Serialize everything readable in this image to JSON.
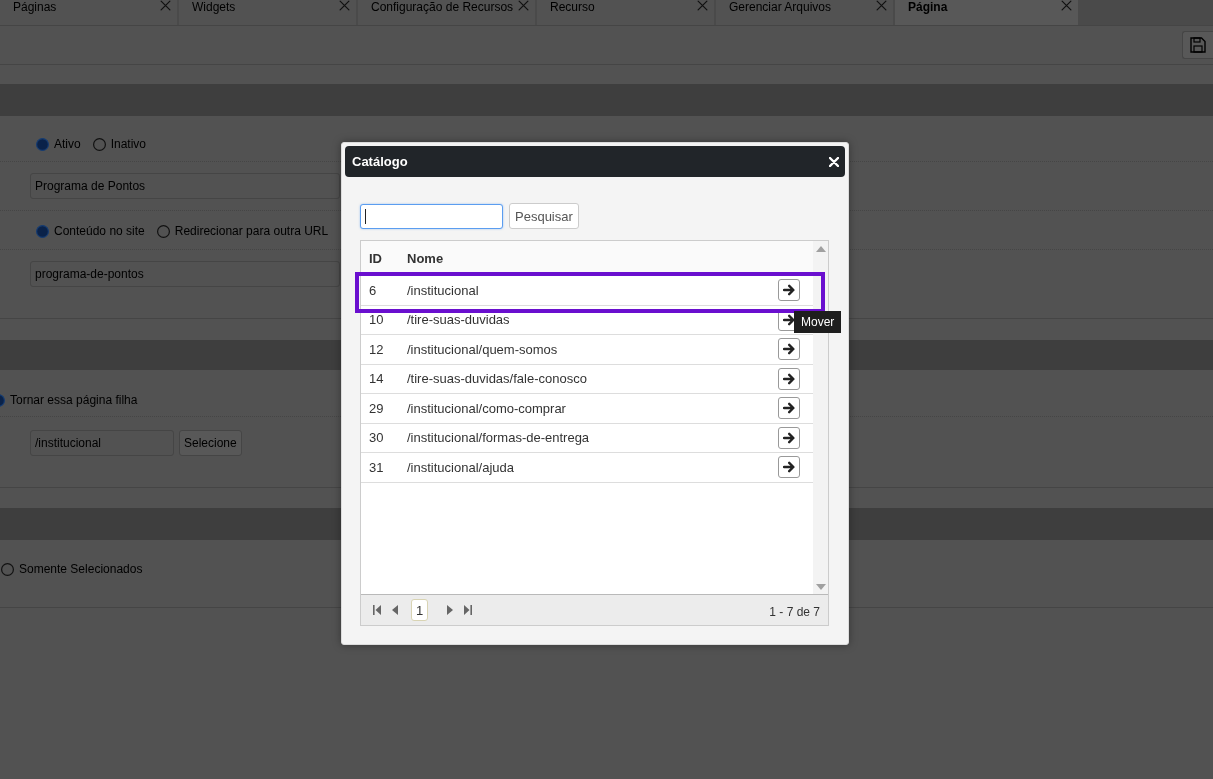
{
  "tabs": [
    {
      "label": "Páginas",
      "selected": false
    },
    {
      "label": "Widgets",
      "selected": false
    },
    {
      "label": "Configuração de Recursos",
      "selected": false
    },
    {
      "label": "Recurso",
      "selected": false
    },
    {
      "label": "Gerenciar Arquivos",
      "selected": false
    },
    {
      "label": "Página",
      "selected": true
    }
  ],
  "form": {
    "status_options": [
      {
        "label": "Ativo",
        "selected": true
      },
      {
        "label": "Inativo",
        "selected": false
      }
    ],
    "title_field": {
      "value": "Programa de Pontos"
    },
    "content_options": [
      {
        "label": "Conteúdo no site",
        "selected": true
      },
      {
        "label": "Redirecionar para outra URL",
        "selected": false
      }
    ],
    "slug_field": {
      "value": "programa-de-pontos"
    },
    "parent_option": {
      "label": "Tornar essa página filha",
      "selected": true
    },
    "parent_field": {
      "value": "/institucional"
    },
    "parent_button": "Selecione",
    "visibility_option": {
      "label": "Somente Selecionados",
      "selected": false
    }
  },
  "modal": {
    "title": "Catálogo",
    "search": {
      "focused": true,
      "button": "Pesquisar"
    },
    "table": {
      "columns": [
        "ID",
        "Nome"
      ],
      "rows": [
        {
          "id": "6",
          "name": "/institucional",
          "highlighted": true,
          "tooltip": "Mover"
        },
        {
          "id": "10",
          "name": "/tire-suas-duvidas",
          "highlighted": false
        },
        {
          "id": "12",
          "name": "/institucional/quem-somos",
          "highlighted": false
        },
        {
          "id": "14",
          "name": "/tire-suas-duvidas/fale-conosco",
          "highlighted": false
        },
        {
          "id": "29",
          "name": "/institucional/como-comprar",
          "highlighted": false
        },
        {
          "id": "30",
          "name": "/institucional/formas-de-entrega",
          "highlighted": false
        },
        {
          "id": "31",
          "name": "/institucional/ajuda",
          "highlighted": false
        }
      ]
    },
    "pager": {
      "pages": [
        {
          "label": "1",
          "selected": true
        }
      ],
      "summary": "1 - 7 de 7"
    }
  }
}
